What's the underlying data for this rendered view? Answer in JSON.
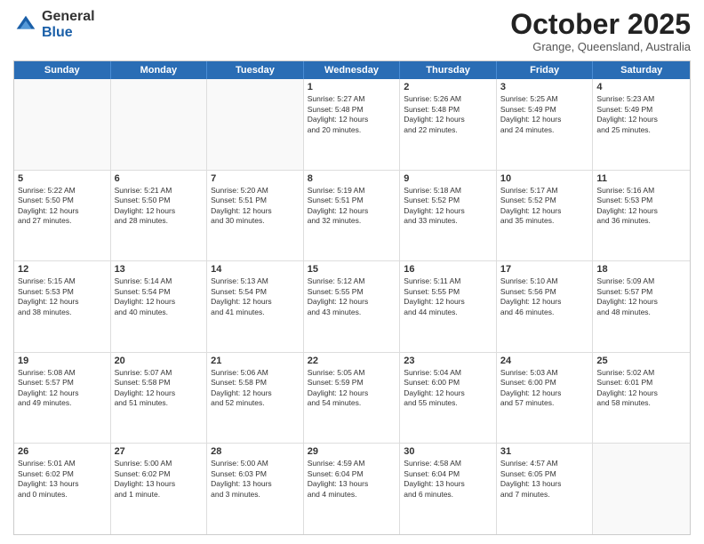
{
  "logo": {
    "general": "General",
    "blue": "Blue"
  },
  "header": {
    "month": "October 2025",
    "location": "Grange, Queensland, Australia"
  },
  "weekdays": [
    "Sunday",
    "Monday",
    "Tuesday",
    "Wednesday",
    "Thursday",
    "Friday",
    "Saturday"
  ],
  "rows": [
    [
      {
        "day": "",
        "info": ""
      },
      {
        "day": "",
        "info": ""
      },
      {
        "day": "",
        "info": ""
      },
      {
        "day": "1",
        "info": "Sunrise: 5:27 AM\nSunset: 5:48 PM\nDaylight: 12 hours\nand 20 minutes."
      },
      {
        "day": "2",
        "info": "Sunrise: 5:26 AM\nSunset: 5:48 PM\nDaylight: 12 hours\nand 22 minutes."
      },
      {
        "day": "3",
        "info": "Sunrise: 5:25 AM\nSunset: 5:49 PM\nDaylight: 12 hours\nand 24 minutes."
      },
      {
        "day": "4",
        "info": "Sunrise: 5:23 AM\nSunset: 5:49 PM\nDaylight: 12 hours\nand 25 minutes."
      }
    ],
    [
      {
        "day": "5",
        "info": "Sunrise: 5:22 AM\nSunset: 5:50 PM\nDaylight: 12 hours\nand 27 minutes."
      },
      {
        "day": "6",
        "info": "Sunrise: 5:21 AM\nSunset: 5:50 PM\nDaylight: 12 hours\nand 28 minutes."
      },
      {
        "day": "7",
        "info": "Sunrise: 5:20 AM\nSunset: 5:51 PM\nDaylight: 12 hours\nand 30 minutes."
      },
      {
        "day": "8",
        "info": "Sunrise: 5:19 AM\nSunset: 5:51 PM\nDaylight: 12 hours\nand 32 minutes."
      },
      {
        "day": "9",
        "info": "Sunrise: 5:18 AM\nSunset: 5:52 PM\nDaylight: 12 hours\nand 33 minutes."
      },
      {
        "day": "10",
        "info": "Sunrise: 5:17 AM\nSunset: 5:52 PM\nDaylight: 12 hours\nand 35 minutes."
      },
      {
        "day": "11",
        "info": "Sunrise: 5:16 AM\nSunset: 5:53 PM\nDaylight: 12 hours\nand 36 minutes."
      }
    ],
    [
      {
        "day": "12",
        "info": "Sunrise: 5:15 AM\nSunset: 5:53 PM\nDaylight: 12 hours\nand 38 minutes."
      },
      {
        "day": "13",
        "info": "Sunrise: 5:14 AM\nSunset: 5:54 PM\nDaylight: 12 hours\nand 40 minutes."
      },
      {
        "day": "14",
        "info": "Sunrise: 5:13 AM\nSunset: 5:54 PM\nDaylight: 12 hours\nand 41 minutes."
      },
      {
        "day": "15",
        "info": "Sunrise: 5:12 AM\nSunset: 5:55 PM\nDaylight: 12 hours\nand 43 minutes."
      },
      {
        "day": "16",
        "info": "Sunrise: 5:11 AM\nSunset: 5:55 PM\nDaylight: 12 hours\nand 44 minutes."
      },
      {
        "day": "17",
        "info": "Sunrise: 5:10 AM\nSunset: 5:56 PM\nDaylight: 12 hours\nand 46 minutes."
      },
      {
        "day": "18",
        "info": "Sunrise: 5:09 AM\nSunset: 5:57 PM\nDaylight: 12 hours\nand 48 minutes."
      }
    ],
    [
      {
        "day": "19",
        "info": "Sunrise: 5:08 AM\nSunset: 5:57 PM\nDaylight: 12 hours\nand 49 minutes."
      },
      {
        "day": "20",
        "info": "Sunrise: 5:07 AM\nSunset: 5:58 PM\nDaylight: 12 hours\nand 51 minutes."
      },
      {
        "day": "21",
        "info": "Sunrise: 5:06 AM\nSunset: 5:58 PM\nDaylight: 12 hours\nand 52 minutes."
      },
      {
        "day": "22",
        "info": "Sunrise: 5:05 AM\nSunset: 5:59 PM\nDaylight: 12 hours\nand 54 minutes."
      },
      {
        "day": "23",
        "info": "Sunrise: 5:04 AM\nSunset: 6:00 PM\nDaylight: 12 hours\nand 55 minutes."
      },
      {
        "day": "24",
        "info": "Sunrise: 5:03 AM\nSunset: 6:00 PM\nDaylight: 12 hours\nand 57 minutes."
      },
      {
        "day": "25",
        "info": "Sunrise: 5:02 AM\nSunset: 6:01 PM\nDaylight: 12 hours\nand 58 minutes."
      }
    ],
    [
      {
        "day": "26",
        "info": "Sunrise: 5:01 AM\nSunset: 6:02 PM\nDaylight: 13 hours\nand 0 minutes."
      },
      {
        "day": "27",
        "info": "Sunrise: 5:00 AM\nSunset: 6:02 PM\nDaylight: 13 hours\nand 1 minute."
      },
      {
        "day": "28",
        "info": "Sunrise: 5:00 AM\nSunset: 6:03 PM\nDaylight: 13 hours\nand 3 minutes."
      },
      {
        "day": "29",
        "info": "Sunrise: 4:59 AM\nSunset: 6:04 PM\nDaylight: 13 hours\nand 4 minutes."
      },
      {
        "day": "30",
        "info": "Sunrise: 4:58 AM\nSunset: 6:04 PM\nDaylight: 13 hours\nand 6 minutes."
      },
      {
        "day": "31",
        "info": "Sunrise: 4:57 AM\nSunset: 6:05 PM\nDaylight: 13 hours\nand 7 minutes."
      },
      {
        "day": "",
        "info": ""
      }
    ]
  ]
}
